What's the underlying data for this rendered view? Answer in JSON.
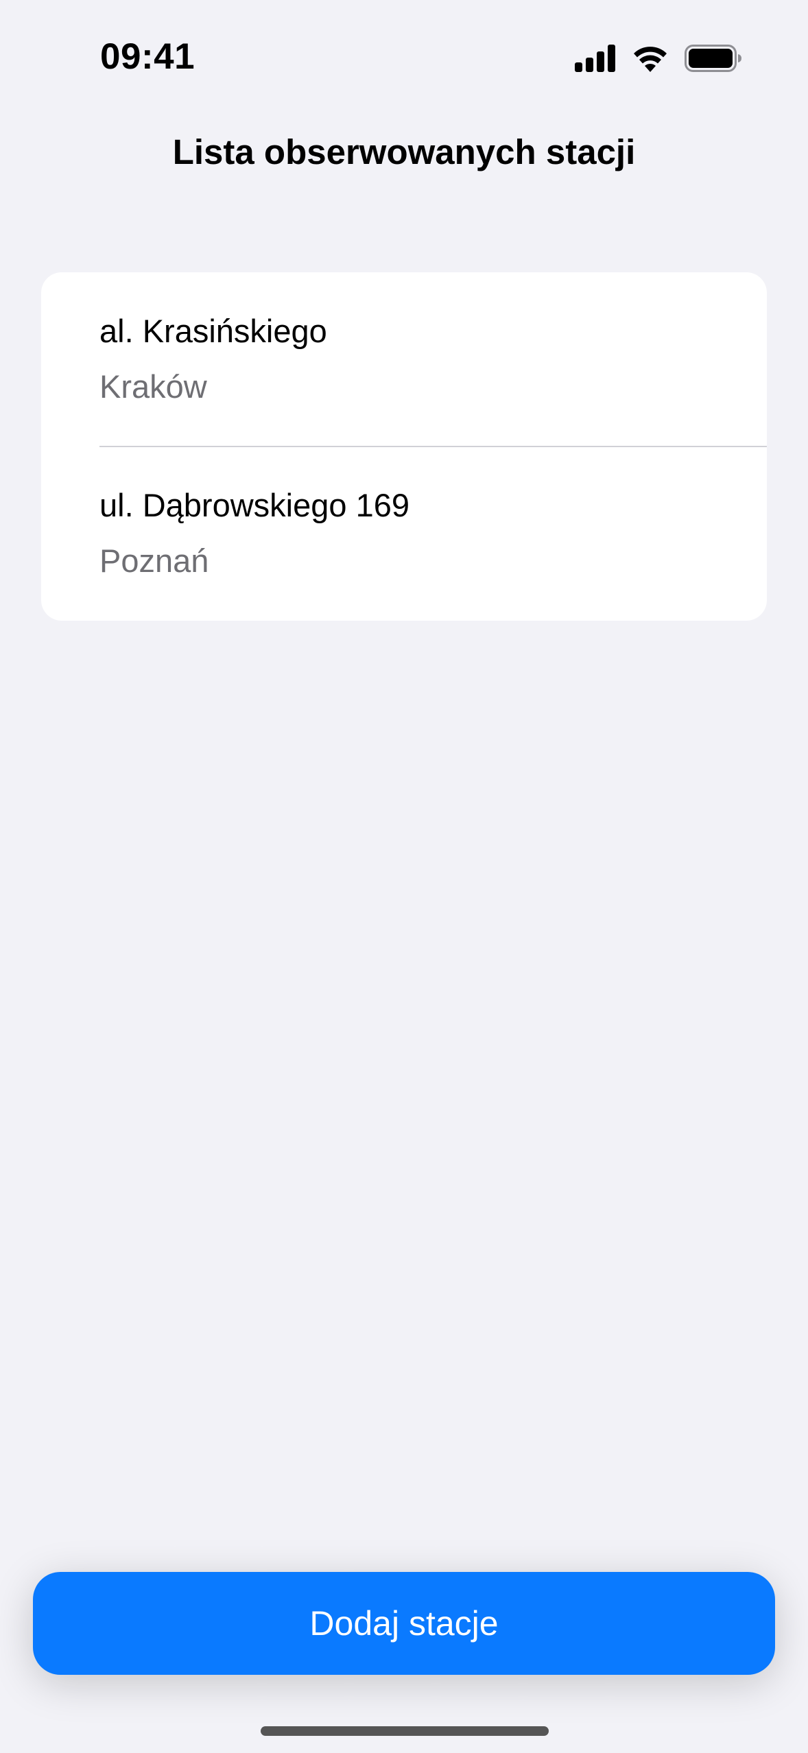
{
  "status_bar": {
    "time": "09:41",
    "signal_icon": "cellular-signal-icon",
    "wifi_icon": "wifi-icon",
    "battery_icon": "battery-icon"
  },
  "header": {
    "title": "Lista obserwowanych stacji"
  },
  "stations": [
    {
      "name": "al. Krasińskiego",
      "city": "Kraków"
    },
    {
      "name": "ul. Dąbrowskiego 169",
      "city": "Poznań"
    }
  ],
  "actions": {
    "add_station_label": "Dodaj stacje"
  },
  "colors": {
    "background": "#f2f2f7",
    "accent": "#0a7aff",
    "secondary_text": "#6e6e73"
  }
}
